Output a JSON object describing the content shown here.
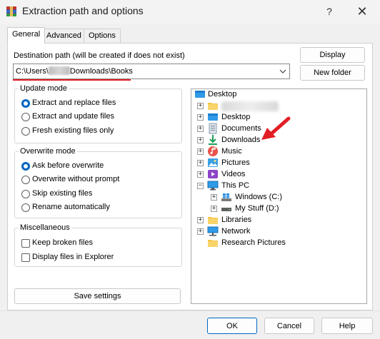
{
  "window": {
    "title": "Extraction path and options",
    "help_label": "?",
    "close_label": "✕"
  },
  "tabs": [
    {
      "label": "General"
    },
    {
      "label": "Advanced"
    },
    {
      "label": "Options"
    }
  ],
  "destination": {
    "label": "Destination path (will be created if does not exist)",
    "path_prefix": "C:\\Users\\",
    "path_suffix": "Downloads\\Books",
    "display_button": "Display",
    "new_folder_button": "New folder"
  },
  "update_mode": {
    "title": "Update mode",
    "options": [
      {
        "label": "Extract and replace files",
        "selected": true
      },
      {
        "label": "Extract and update files",
        "selected": false
      },
      {
        "label": "Fresh existing files only",
        "selected": false
      }
    ]
  },
  "overwrite_mode": {
    "title": "Overwrite mode",
    "options": [
      {
        "label": "Ask before overwrite",
        "selected": true
      },
      {
        "label": "Overwrite without prompt",
        "selected": false
      },
      {
        "label": "Skip existing files",
        "selected": false
      },
      {
        "label": "Rename automatically",
        "selected": false
      }
    ]
  },
  "misc": {
    "title": "Miscellaneous",
    "options": [
      {
        "label": "Keep broken files",
        "checked": false
      },
      {
        "label": "Display files in Explorer",
        "checked": false
      }
    ]
  },
  "save_settings_button": "Save settings",
  "tree": {
    "items": [
      {
        "label": "Desktop",
        "icon": "desktop-icon"
      },
      {
        "label": "",
        "icon": "user-folder-icon"
      },
      {
        "label": "Desktop",
        "icon": "desktop-icon"
      },
      {
        "label": "Documents",
        "icon": "documents-icon"
      },
      {
        "label": "Downloads",
        "icon": "downloads-icon"
      },
      {
        "label": "Music",
        "icon": "music-icon"
      },
      {
        "label": "Pictures",
        "icon": "pictures-icon"
      },
      {
        "label": "Videos",
        "icon": "videos-icon"
      },
      {
        "label": "This PC",
        "icon": "computer-icon"
      },
      {
        "label": "Windows (C:)",
        "icon": "drive-icon"
      },
      {
        "label": "My Stuff (D:)",
        "icon": "drive-icon"
      },
      {
        "label": "Libraries",
        "icon": "folder-icon"
      },
      {
        "label": "Network",
        "icon": "network-icon"
      },
      {
        "label": "Research Pictures",
        "icon": "folder-icon"
      }
    ]
  },
  "footer": {
    "ok": "OK",
    "cancel": "Cancel",
    "help": "Help"
  },
  "colors": {
    "accent": "#0067c0",
    "annotation": "#e21d24"
  }
}
